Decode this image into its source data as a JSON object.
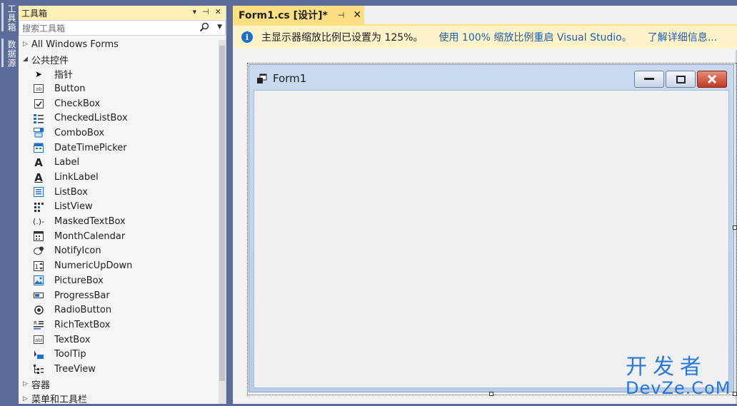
{
  "side_tabs": {
    "toolbox": "工具箱",
    "datasource": "数据源"
  },
  "toolbox": {
    "title": "工具箱",
    "search_placeholder": "搜索工具箱",
    "groups": {
      "all_windows_forms": "All Windows Forms",
      "common_controls": "公共控件",
      "containers": "容器",
      "menus_toolbars": "菜单和工具栏"
    },
    "items": [
      {
        "label": "指针",
        "icon": "pointer-icon"
      },
      {
        "label": "Button",
        "icon": "button-icon"
      },
      {
        "label": "CheckBox",
        "icon": "checkbox-icon"
      },
      {
        "label": "CheckedListBox",
        "icon": "checkedlistbox-icon"
      },
      {
        "label": "ComboBox",
        "icon": "combobox-icon"
      },
      {
        "label": "DateTimePicker",
        "icon": "datetimepicker-icon"
      },
      {
        "label": "Label",
        "icon": "label-icon"
      },
      {
        "label": "LinkLabel",
        "icon": "linklabel-icon"
      },
      {
        "label": "ListBox",
        "icon": "listbox-icon"
      },
      {
        "label": "ListView",
        "icon": "listview-icon"
      },
      {
        "label": "MaskedTextBox",
        "icon": "maskedtextbox-icon"
      },
      {
        "label": "MonthCalendar",
        "icon": "monthcalendar-icon"
      },
      {
        "label": "NotifyIcon",
        "icon": "notifyicon-icon"
      },
      {
        "label": "NumericUpDown",
        "icon": "numericupdown-icon"
      },
      {
        "label": "PictureBox",
        "icon": "picturebox-icon"
      },
      {
        "label": "ProgressBar",
        "icon": "progressbar-icon"
      },
      {
        "label": "RadioButton",
        "icon": "radiobutton-icon"
      },
      {
        "label": "RichTextBox",
        "icon": "richtextbox-icon"
      },
      {
        "label": "TextBox",
        "icon": "textbox-icon"
      },
      {
        "label": "ToolTip",
        "icon": "tooltip-icon"
      },
      {
        "label": "TreeView",
        "icon": "treeview-icon"
      }
    ]
  },
  "document_tab": {
    "label": "Form1.cs [设计]*"
  },
  "infobar": {
    "message": "主显示器缩放比例已设置为 125%。",
    "restart_link": "使用 100% 缩放比例重启 Visual Studio。",
    "learn_more_link": "了解详细信息..."
  },
  "form": {
    "title": "Form1"
  },
  "watermark": {
    "line1": "开发者",
    "line2": "DevZe.CoM"
  },
  "colors": {
    "tab_active": "#fcde83",
    "infobar_bg": "#fef3c8",
    "link": "#1a5fb4",
    "chrome": "#5d6b99"
  }
}
